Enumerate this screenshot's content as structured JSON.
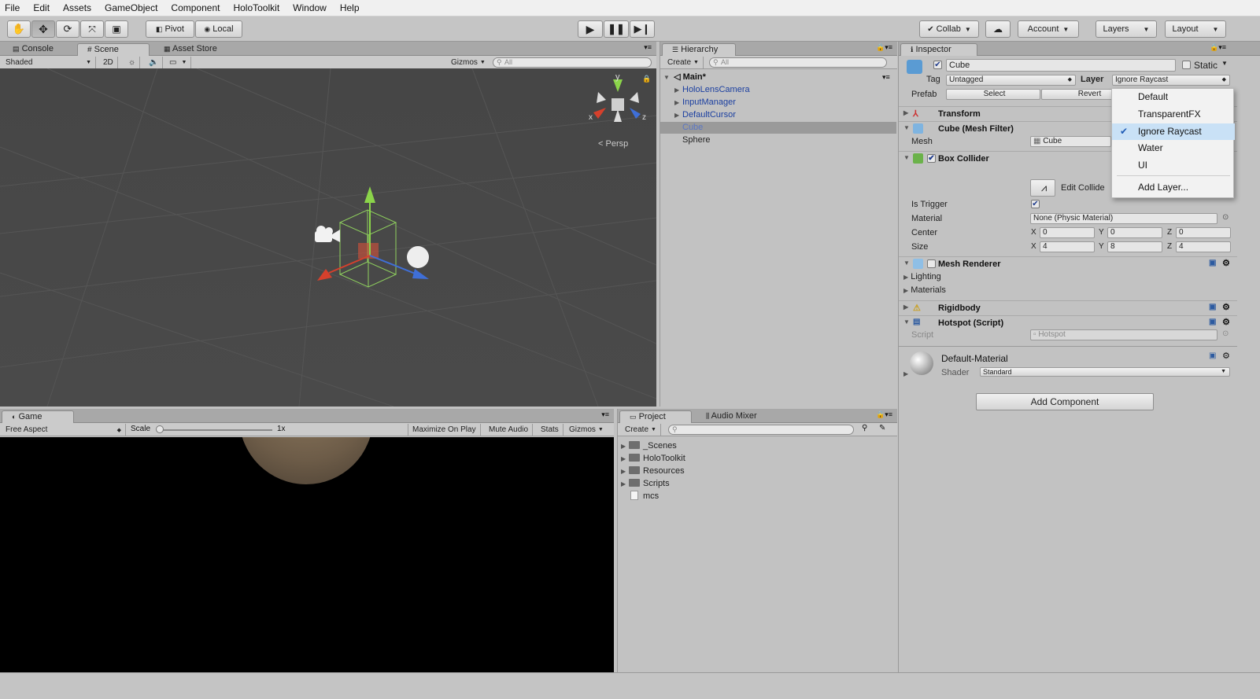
{
  "menubar": [
    "File",
    "Edit",
    "Assets",
    "GameObject",
    "Component",
    "HoloToolkit",
    "Window",
    "Help"
  ],
  "toolbar": {
    "pivot": "Pivot",
    "local": "Local",
    "collab": "Collab",
    "account": "Account",
    "layers": "Layers",
    "layout": "Layout"
  },
  "scene_panel": {
    "tabs": [
      "Console",
      "Scene",
      "Asset Store"
    ],
    "shading": "Shaded",
    "mode_2d": "2D",
    "gizmos": "Gizmos",
    "search_placeholder": "All",
    "persp": "Persp",
    "axis": {
      "x": "x",
      "y": "y",
      "z": "z"
    }
  },
  "hierarchy": {
    "tab": "Hierarchy",
    "create": "Create",
    "search_placeholder": "All",
    "scene_name": "Main*",
    "items": [
      {
        "label": "HoloLensCamera",
        "expandable": true
      },
      {
        "label": "InputManager",
        "expandable": true
      },
      {
        "label": "DefaultCursor",
        "expandable": true
      },
      {
        "label": "Cube",
        "expandable": false,
        "selected": true
      },
      {
        "label": "Sphere",
        "expandable": false
      }
    ]
  },
  "inspector": {
    "tab": "Inspector",
    "object_name": "Cube",
    "static": "Static",
    "tag_label": "Tag",
    "tag_value": "Untagged",
    "layer_label": "Layer",
    "layer_value": "Ignore Raycast",
    "prefab_label": "Prefab",
    "prefab_select": "Select",
    "prefab_revert": "Revert",
    "transform": "Transform",
    "mesh_filter": "Cube (Mesh Filter)",
    "mesh_label": "Mesh",
    "mesh_value": "Cube",
    "box_collider": "Box Collider",
    "edit_collider": "Edit Collide",
    "is_trigger": "Is Trigger",
    "material_label": "Material",
    "material_value": "None (Physic Material)",
    "center_label": "Center",
    "center": {
      "x": "0",
      "y": "0",
      "z": "0"
    },
    "size_label": "Size",
    "size": {
      "x": "4",
      "y": "8",
      "z": "4"
    },
    "mesh_renderer": "Mesh Renderer",
    "lighting": "Lighting",
    "materials": "Materials",
    "rigidbody": "Rigidbody",
    "hotspot": "Hotspot (Script)",
    "script_label": "Script",
    "script_value": "Hotspot",
    "default_material": "Default-Material",
    "shader_label": "Shader",
    "shader_value": "Standard",
    "add_component": "Add Component",
    "axis_labels": {
      "x": "X",
      "y": "Y",
      "z": "Z"
    }
  },
  "layer_dropdown": {
    "items": [
      "Default",
      "TransparentFX",
      "Ignore Raycast",
      "Water",
      "UI",
      "Add Layer..."
    ],
    "selected": "Ignore Raycast"
  },
  "game_panel": {
    "tab": "Game",
    "aspect": "Free Aspect",
    "scale_label": "Scale",
    "scale_value": "1x",
    "maximize": "Maximize On Play",
    "mute": "Mute Audio",
    "stats": "Stats",
    "gizmos": "Gizmos"
  },
  "project_panel": {
    "tabs": [
      "Project",
      "Audio Mixer"
    ],
    "create": "Create",
    "items": [
      {
        "label": "_Scenes",
        "type": "folder"
      },
      {
        "label": "HoloToolkit",
        "type": "folder"
      },
      {
        "label": "Resources",
        "type": "folder"
      },
      {
        "label": "Scripts",
        "type": "folder"
      },
      {
        "label": "mcs",
        "type": "file"
      }
    ]
  },
  "colors": {
    "selected_text": "#5a76c4",
    "hierarchy_link": "#1b3fa0",
    "dropdown_highlight": "#c9e1f6",
    "scene_bg": "#484848"
  }
}
